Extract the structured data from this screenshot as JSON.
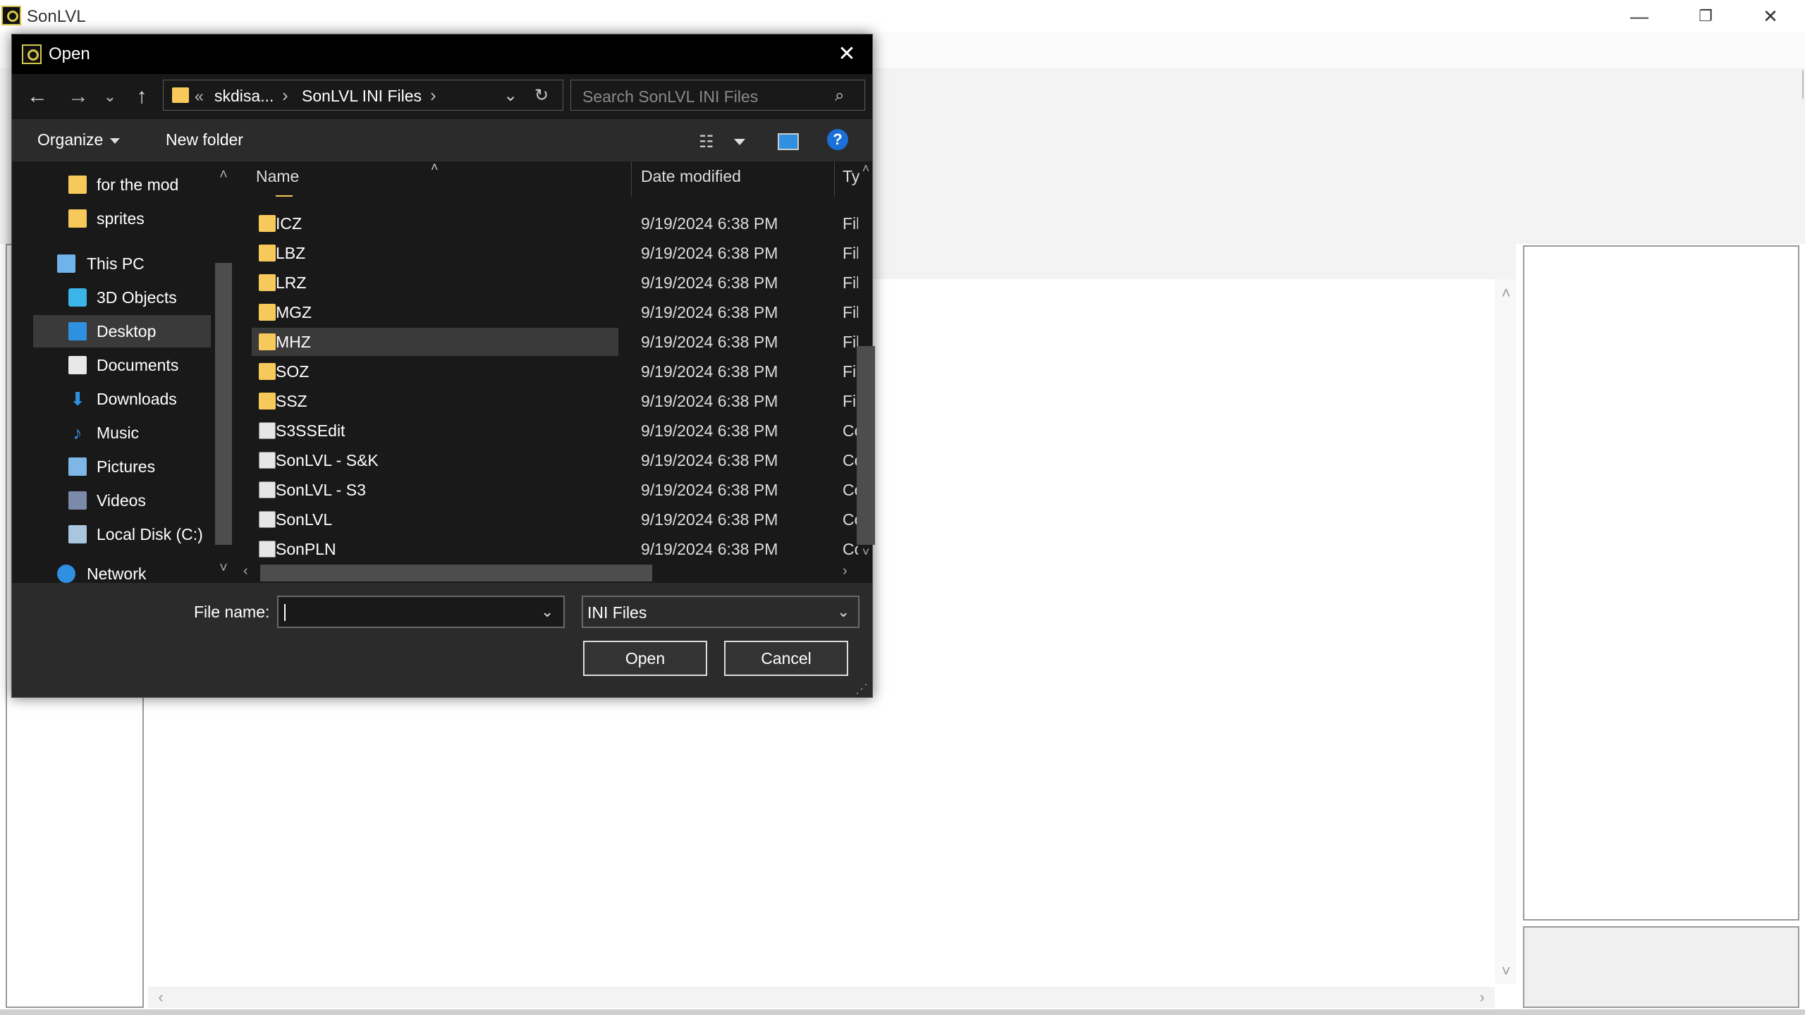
{
  "app": {
    "title": "SonLVL",
    "controls": {
      "minimize": "—",
      "restore": "❐",
      "close": "✕"
    }
  },
  "dialog": {
    "title": "Open",
    "close_icon": "✕",
    "nav": {
      "back": "←",
      "forward": "→",
      "recent": "⌄",
      "up": "↑"
    },
    "address": {
      "overflow": "«",
      "segments": [
        "skdisa...",
        "SonLVL INI Files"
      ],
      "separator": "›",
      "dropdown": "⌄",
      "refresh": "↻"
    },
    "search": {
      "placeholder": "Search SonLVL INI Files",
      "icon": "⌕"
    },
    "commands": {
      "organize": "Organize",
      "new_folder": "New folder",
      "help": "?"
    },
    "navpane": {
      "items": [
        {
          "label": "for the mod",
          "icon": "folder-icon"
        },
        {
          "label": "sprites",
          "icon": "folder-icon"
        },
        {
          "label": "This PC",
          "icon": "computer-icon"
        },
        {
          "label": "3D Objects",
          "icon": "cube-icon"
        },
        {
          "label": "Desktop",
          "icon": "desktop-icon",
          "selected": true
        },
        {
          "label": "Documents",
          "icon": "document-icon"
        },
        {
          "label": "Downloads",
          "icon": "download-icon"
        },
        {
          "label": "Music",
          "icon": "music-icon"
        },
        {
          "label": "Pictures",
          "icon": "pictures-icon"
        },
        {
          "label": "Videos",
          "icon": "video-icon"
        },
        {
          "label": "Local Disk (C:)",
          "icon": "disk-icon"
        },
        {
          "label": "Network",
          "icon": "network-icon"
        }
      ]
    },
    "columns": {
      "name": "Name",
      "date": "Date modified",
      "type": "Ty"
    },
    "files": [
      {
        "name": "ICZ",
        "date": "9/19/2024 6:38 PM",
        "type": "Fil",
        "kind": "folder"
      },
      {
        "name": "LBZ",
        "date": "9/19/2024 6:38 PM",
        "type": "Fil",
        "kind": "folder"
      },
      {
        "name": "LRZ",
        "date": "9/19/2024 6:38 PM",
        "type": "Fil",
        "kind": "folder"
      },
      {
        "name": "MGZ",
        "date": "9/19/2024 6:38 PM",
        "type": "Fil",
        "kind": "folder"
      },
      {
        "name": "MHZ",
        "date": "9/19/2024 6:38 PM",
        "type": "Fil",
        "kind": "folder",
        "hover": true
      },
      {
        "name": "SOZ",
        "date": "9/19/2024 6:38 PM",
        "type": "Fil",
        "kind": "folder"
      },
      {
        "name": "SSZ",
        "date": "9/19/2024 6:38 PM",
        "type": "Fil",
        "kind": "folder"
      },
      {
        "name": "S3SSEdit",
        "date": "9/19/2024 6:38 PM",
        "type": "Co",
        "kind": "config"
      },
      {
        "name": "SonLVL - S&K",
        "date": "9/19/2024 6:38 PM",
        "type": "Co",
        "kind": "config"
      },
      {
        "name": "SonLVL - S3",
        "date": "9/19/2024 6:38 PM",
        "type": "Co",
        "kind": "config"
      },
      {
        "name": "SonLVL",
        "date": "9/19/2024 6:38 PM",
        "type": "Co",
        "kind": "config"
      },
      {
        "name": "SonPLN",
        "date": "9/19/2024 6:38 PM",
        "type": "Co",
        "kind": "config"
      }
    ],
    "filename": {
      "label": "File name:",
      "value": ""
    },
    "filetype": {
      "selected": "INI Files"
    },
    "buttons": {
      "open": "Open",
      "cancel": "Cancel"
    }
  }
}
